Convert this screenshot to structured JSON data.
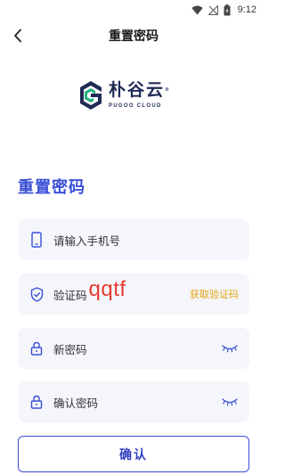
{
  "status_bar": {
    "time": "9:12"
  },
  "header": {
    "title": "重置密码"
  },
  "logo": {
    "cn": "朴谷云",
    "reg": "®",
    "en": "PUGOO CLOUD"
  },
  "form": {
    "heading": "重置密码",
    "phone": {
      "placeholder": "请输入手机号"
    },
    "code": {
      "placeholder": "验证码",
      "handwritten_value": "qqtf",
      "get_code_label": "获取验证码"
    },
    "new_password": {
      "placeholder": "新密码"
    },
    "confirm_password": {
      "placeholder": "确认密码"
    },
    "submit_label": "确认"
  },
  "colors": {
    "accent": "#3b4fd6",
    "link": "#e6a417",
    "field_bg": "#f4f6fc",
    "handwrite": "#e63b2e"
  }
}
